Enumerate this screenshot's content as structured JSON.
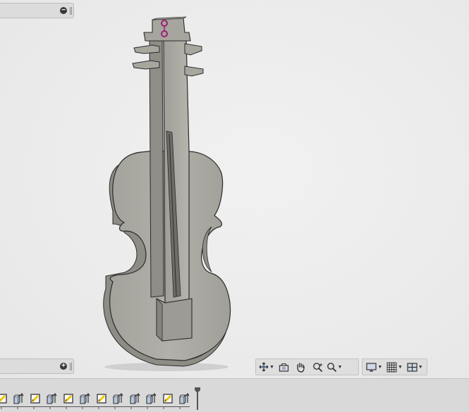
{
  "browser_panel": {
    "collapse_button": "−"
  },
  "comments_panel": {
    "expand_button": "+"
  },
  "navigation_bar": {
    "tools": [
      {
        "name": "orbit-icon",
        "has_dropdown": true
      },
      {
        "name": "look-at-icon",
        "has_dropdown": false
      },
      {
        "name": "pan-icon",
        "has_dropdown": false
      },
      {
        "name": "zoom-icon",
        "has_dropdown": false
      },
      {
        "name": "fit-icon",
        "has_dropdown": true
      }
    ],
    "display": [
      {
        "name": "display-settings-icon",
        "has_dropdown": true
      },
      {
        "name": "grid-snaps-icon",
        "has_dropdown": true
      },
      {
        "name": "viewports-icon",
        "has_dropdown": true
      }
    ]
  },
  "timeline": {
    "features": [
      "sketch",
      "extrude",
      "sketch",
      "extrude",
      "sketch",
      "extrude",
      "sketch",
      "extrude",
      "extrude",
      "extrude",
      "sketch",
      "extrude"
    ]
  },
  "colors": {
    "model_face": "#a9a8a1",
    "model_side": "#8e8d86",
    "model_edge": "#2b2b2b",
    "selection": "#9b1f73",
    "sketch_icon": "#f2c200",
    "background": "#ececec"
  }
}
